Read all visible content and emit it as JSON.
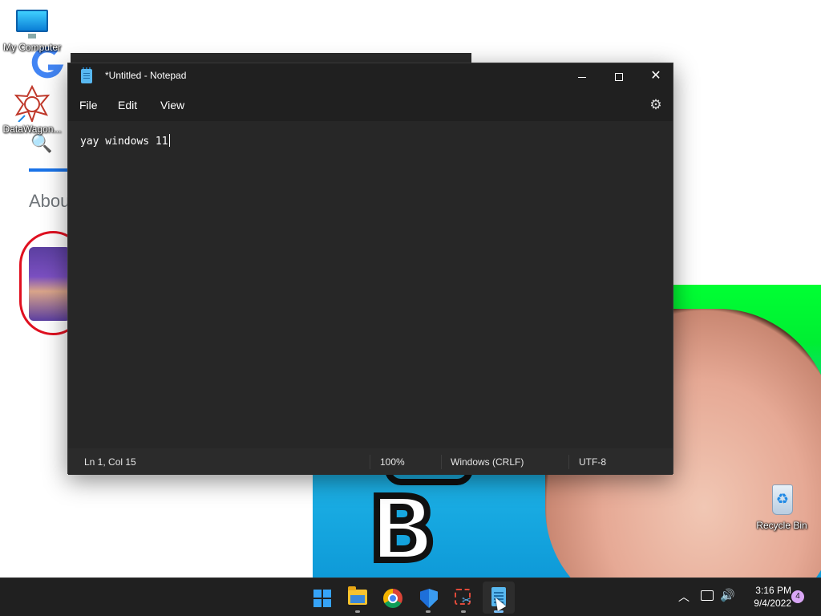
{
  "desktop": {
    "icons": [
      {
        "label": "My Computer",
        "icon": "monitor-icon"
      },
      {
        "label": "DataWagon...",
        "icon": "datawagon-icon"
      },
      {
        "label": "Recycle Bin",
        "icon": "recycle-bin-icon"
      }
    ]
  },
  "background": {
    "about_text": "Abou"
  },
  "notepad": {
    "title": "*Untitled - Notepad",
    "menu": [
      "File",
      "Edit",
      "View"
    ],
    "content": "yay windows 11",
    "status": {
      "position": "Ln 1, Col 15",
      "zoom": "100%",
      "line_ending": "Windows (CRLF)",
      "encoding": "UTF-8"
    }
  },
  "taskbar": {
    "apps": [
      {
        "name": "Start",
        "icon": "windows-start-icon"
      },
      {
        "name": "File Explorer",
        "icon": "folder-icon"
      },
      {
        "name": "Google Chrome",
        "icon": "chrome-icon"
      },
      {
        "name": "Windows Security",
        "icon": "shield-icon"
      },
      {
        "name": "Snipping Tool",
        "icon": "snip-icon"
      },
      {
        "name": "Notepad",
        "icon": "notepad-icon",
        "active": true
      }
    ],
    "tray": {
      "time": "3:16 PM",
      "date": "9/4/2022",
      "notifications": "4"
    }
  },
  "colors": {
    "accent": "#7cc4ff",
    "window_bg": "#202020",
    "editor_bg": "#272727",
    "notification_badge": "#d9a6f5"
  }
}
